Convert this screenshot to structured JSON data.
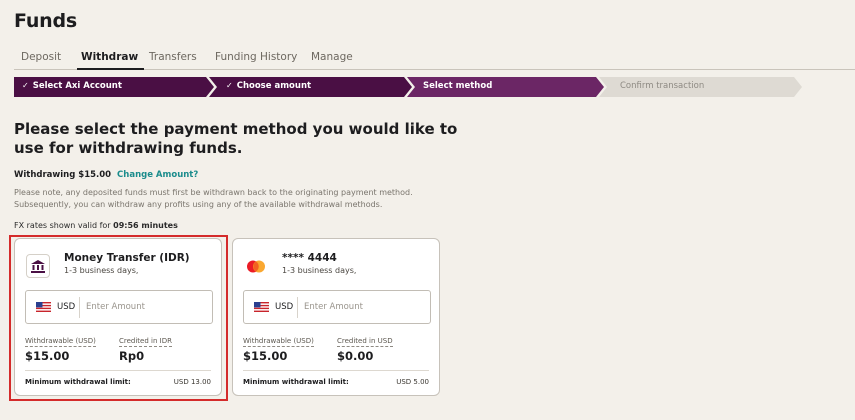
{
  "page": {
    "title": "Funds"
  },
  "tabs": [
    {
      "label": "Deposit",
      "active": false
    },
    {
      "label": "Withdraw",
      "active": true
    },
    {
      "label": "Transfers",
      "active": false
    },
    {
      "label": "Funding History",
      "active": false
    },
    {
      "label": "Manage",
      "active": false
    }
  ],
  "steps": [
    {
      "label": "Select Axi Account",
      "state": "done"
    },
    {
      "label": "Choose amount",
      "state": "done"
    },
    {
      "label": "Select method",
      "state": "current"
    },
    {
      "label": "Confirm transaction",
      "state": "pending"
    }
  ],
  "step_check": "✓",
  "colors": {
    "step_dark": "#4a0f44",
    "step_current": "#6b2665",
    "step_pending": "#dedad3",
    "highlight": "#d42b2b",
    "link": "#1a8c8c"
  },
  "heading": "Please select the payment method you would like to use for withdrawing funds.",
  "withdrawing": {
    "label": "Withdrawing $15.00",
    "link": "Change Amount?"
  },
  "note": "Please note, any deposited funds must first be withdrawn back to the originating payment method. Subsequently, you can withdraw any profits using any of the available withdrawal methods.",
  "fx": {
    "prefix": "FX rates shown valid for",
    "time": "09:56 minutes"
  },
  "methods": [
    {
      "icon": "bank-icon",
      "name": "Money Transfer (IDR)",
      "sub": "1-3 business days,",
      "currency": "USD",
      "placeholder": "Enter Amount",
      "amount_value": "",
      "withdrawable_label": "Withdrawable (USD)",
      "withdrawable_value": "$15.00",
      "credited_label": "Credited in IDR",
      "credited_value": "Rp0",
      "min_label": "Minimum withdrawal limit:",
      "min_value": "USD 13.00",
      "selected": true
    },
    {
      "icon": "mastercard-icon",
      "name": "**** 4444",
      "sub": "1-3 business days,",
      "currency": "USD",
      "placeholder": "Enter Amount",
      "amount_value": "",
      "withdrawable_label": "Withdrawable (USD)",
      "withdrawable_value": "$15.00",
      "credited_label": "Credited in USD",
      "credited_value": "$0.00",
      "min_label": "Minimum withdrawal limit:",
      "min_value": "USD 5.00",
      "selected": false
    }
  ]
}
